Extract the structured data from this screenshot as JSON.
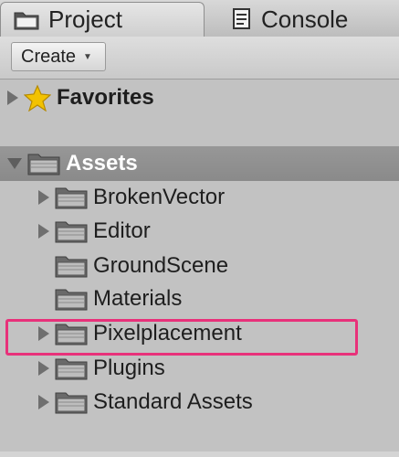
{
  "tabs": [
    {
      "label": "Project",
      "icon": "folder-icon",
      "active": true
    },
    {
      "label": "Console",
      "icon": "console-icon",
      "active": false
    }
  ],
  "toolbar": {
    "create_label": "Create",
    "create_caret": "▼"
  },
  "favorites": {
    "label": "Favorites",
    "icon": "star-icon",
    "expanded": false
  },
  "assets": {
    "label": "Assets",
    "expanded": true,
    "children": [
      {
        "label": "BrokenVector",
        "has_children": true
      },
      {
        "label": "Editor",
        "has_children": true
      },
      {
        "label": "GroundScene",
        "has_children": false
      },
      {
        "label": "Materials",
        "has_children": false
      },
      {
        "label": "Pixelplacement",
        "has_children": true,
        "highlighted": true
      },
      {
        "label": "Plugins",
        "has_children": true
      },
      {
        "label": "Standard Assets",
        "has_children": true
      }
    ]
  },
  "colors": {
    "highlight": "#e8317a",
    "assets_row": "#8f8f8f",
    "panel_bg": "#c2c2c2"
  }
}
